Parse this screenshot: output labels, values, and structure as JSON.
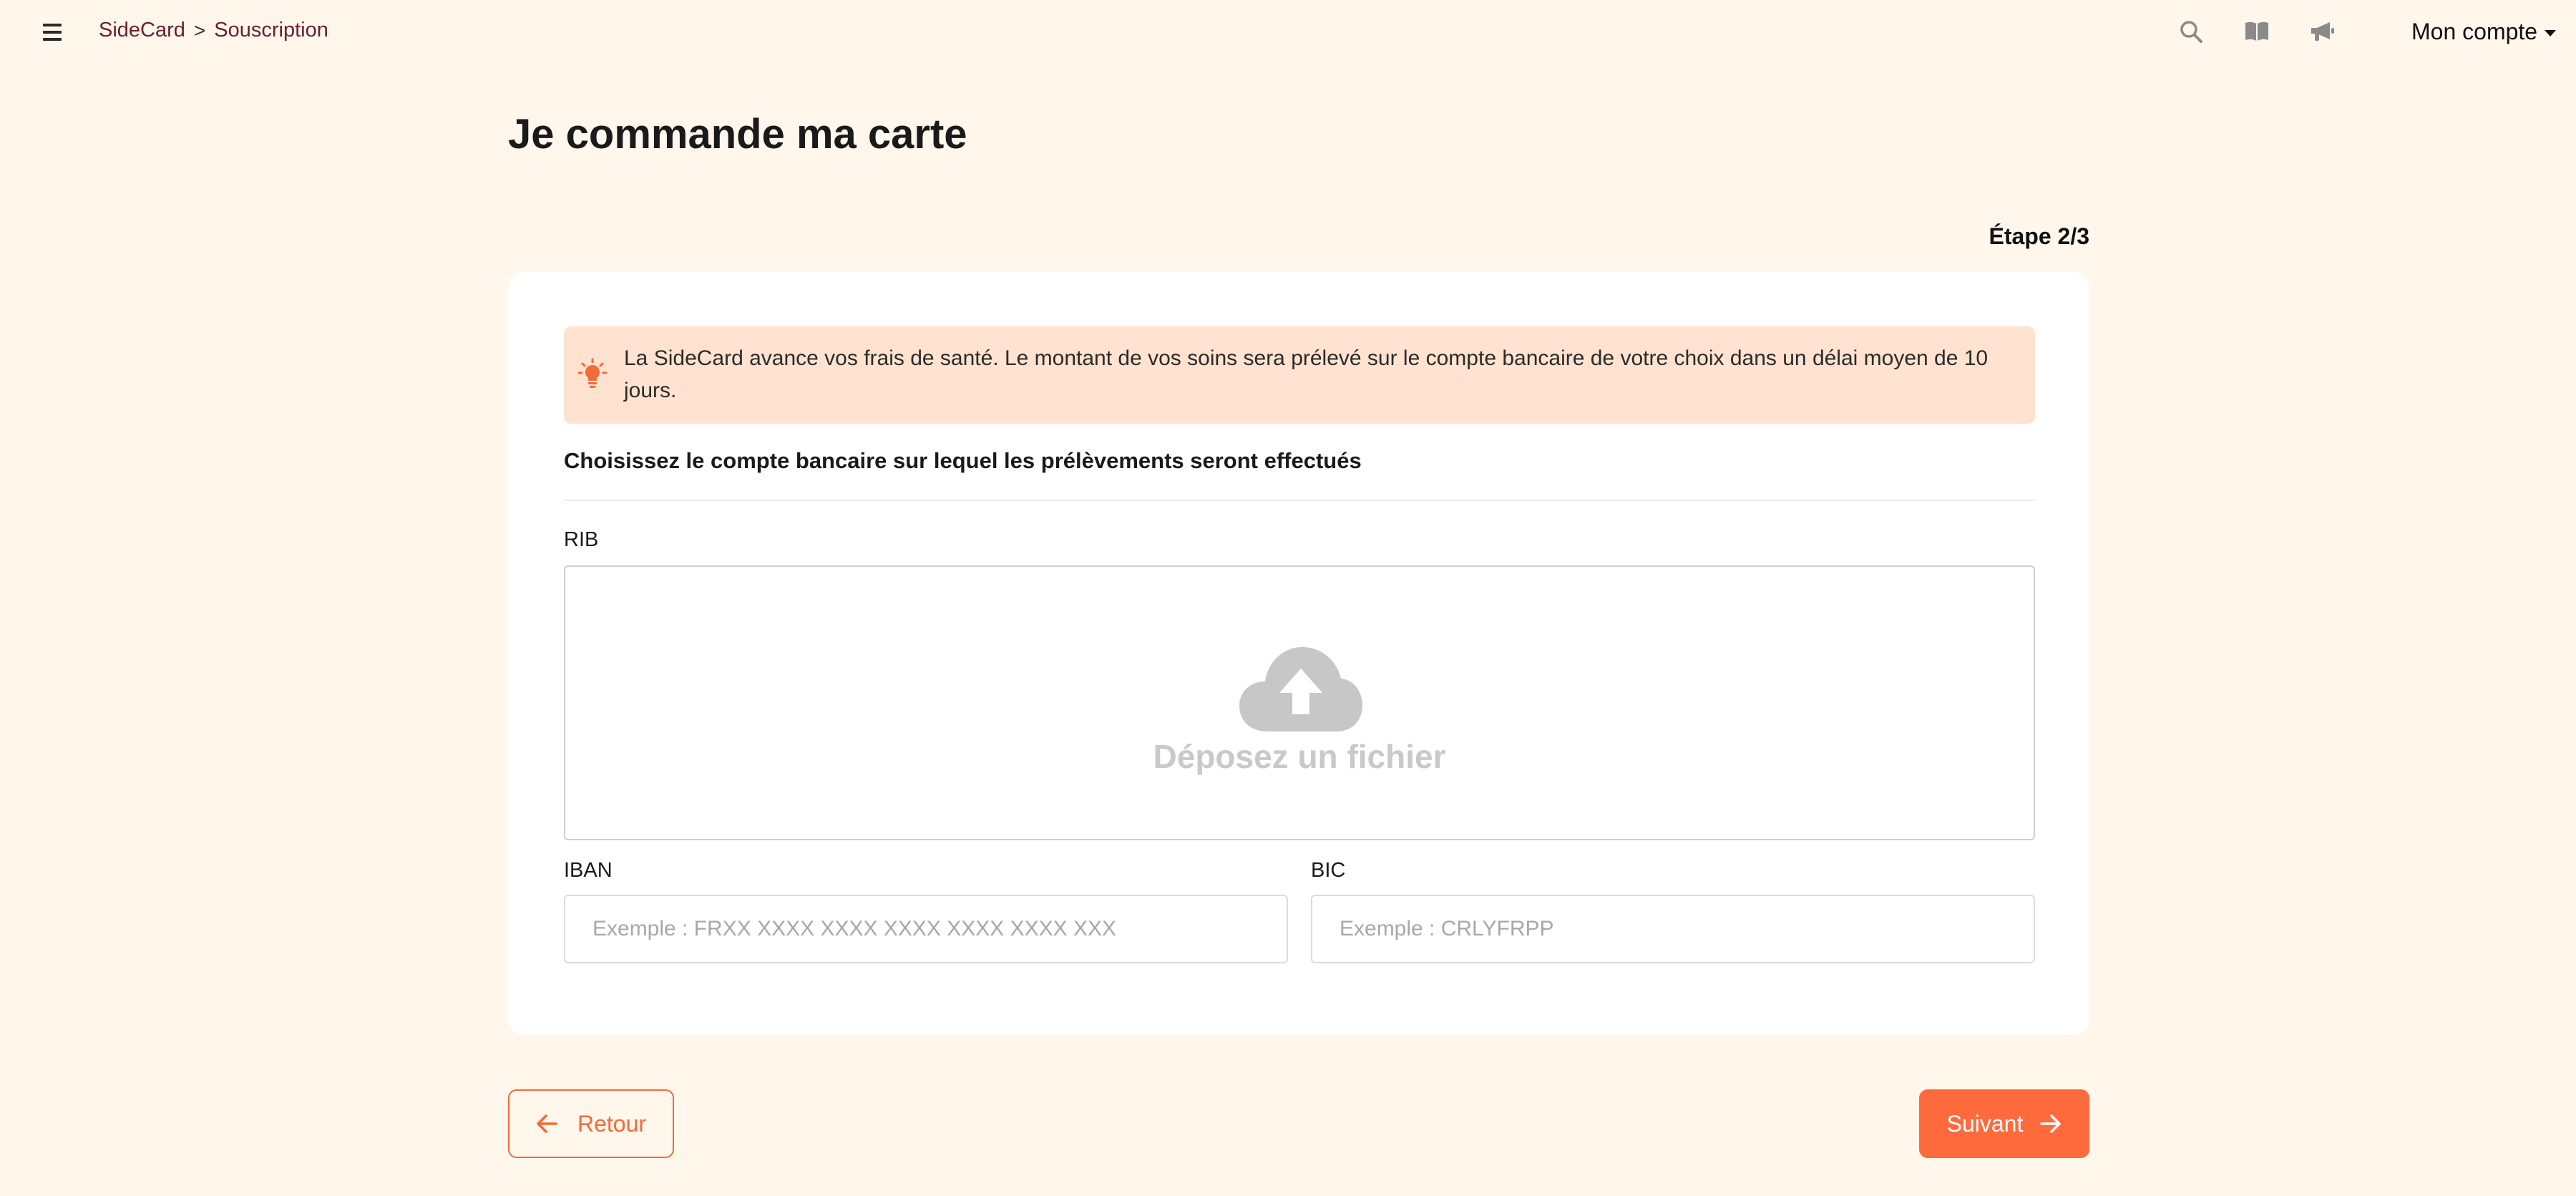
{
  "breadcrumb": {
    "root": "SideCard",
    "separator": ">",
    "current": "Souscription"
  },
  "header": {
    "icons": [
      "search-icon",
      "book-icon",
      "megaphone-icon"
    ],
    "account_label": "Mon compte"
  },
  "page": {
    "title": "Je commande ma carte",
    "step": "Étape 2/3"
  },
  "info_banner": {
    "icon": "lightbulb-icon",
    "text": "La SideCard avance vos frais de santé. Le montant de vos soins sera prélevé sur le compte bancaire de votre choix dans un délai moyen de 10 jours."
  },
  "form": {
    "section_title": "Choisissez le compte bancaire sur lequel les prélèvements seront effectués",
    "rib": {
      "label": "RIB",
      "dropzone_text": "Déposez un fichier",
      "icon": "cloud-upload-icon"
    },
    "iban": {
      "label": "IBAN",
      "value": "",
      "placeholder": "Exemple : FRXX XXXX XXXX XXXX XXXX XXXX XXX"
    },
    "bic": {
      "label": "BIC",
      "value": "",
      "placeholder": "Exemple : CRLYFRPP"
    }
  },
  "actions": {
    "back_label": "Retour",
    "next_label": "Suivant"
  },
  "colors": {
    "background": "#FFF6EC",
    "accent": "#FF6A3D",
    "breadcrumb": "#6b1e2e",
    "banner": "#FFE2CF"
  }
}
